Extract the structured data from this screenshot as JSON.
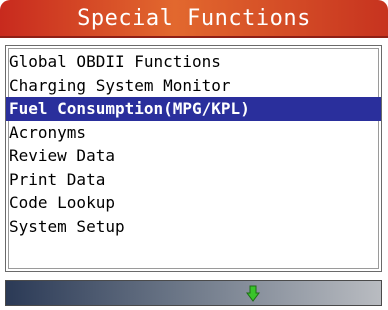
{
  "header": {
    "title": "Special Functions"
  },
  "menu": {
    "items": [
      "Global OBDII Functions",
      "Charging System Monitor",
      "Fuel Consumption(MPG/KPL)",
      "Acronyms",
      "Review Data",
      "Print Data",
      "Code Lookup",
      "System Setup"
    ],
    "selected_index": 2
  },
  "footer": {
    "scroll_icon": "down-arrow-icon"
  },
  "colors": {
    "title_bar": "#d8482a",
    "selection": "#2a2f9c",
    "arrow": "#39c42a"
  }
}
